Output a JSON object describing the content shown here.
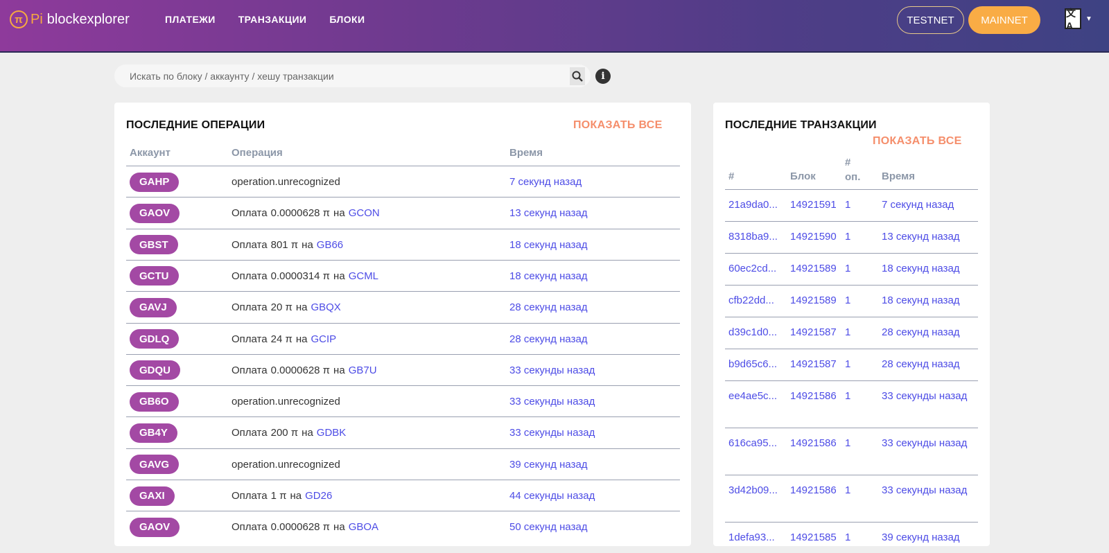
{
  "header": {
    "logo_symbol": "π",
    "logo_pi": "Pi",
    "logo_text": "blockexplorer",
    "nav": [
      "ПЛАТЕЖИ",
      "ТРАНЗАКЦИИ",
      "БЛОКИ"
    ],
    "testnet": "TESTNET",
    "mainnet": "MAINNET",
    "lang_icon": "文A",
    "accent_color": "#f9ac45"
  },
  "search": {
    "placeholder": "Искать по блоку / аккаунту / хешу транзакции"
  },
  "operations": {
    "title": "ПОСЛЕДНИЕ ОПЕРАЦИИ",
    "show_all": "ПОКАЗАТЬ ВСЕ",
    "columns": [
      "Аккаунт",
      "Операция",
      "Время"
    ],
    "rows": [
      {
        "account": "GAHP",
        "op": "operation.unrecognized",
        "amount": "",
        "to_word": "",
        "dest": "",
        "time": "7 секунд назад"
      },
      {
        "account": "GAOV",
        "op": "Оплата",
        "amount": "0.0000628 π",
        "to_word": "на",
        "dest": "GCON",
        "time": "13 секунд назад"
      },
      {
        "account": "GBST",
        "op": "Оплата",
        "amount": "801 π",
        "to_word": "на",
        "dest": "GB66",
        "time": "18 секунд назад"
      },
      {
        "account": "GCTU",
        "op": "Оплата",
        "amount": "0.0000314 π",
        "to_word": "на",
        "dest": "GCML",
        "time": "18 секунд назад"
      },
      {
        "account": "GAVJ",
        "op": "Оплата",
        "amount": "20 π",
        "to_word": "на",
        "dest": "GBQX",
        "time": "28 секунд назад"
      },
      {
        "account": "GDLQ",
        "op": "Оплата",
        "amount": "24 π",
        "to_word": "на",
        "dest": "GCIP",
        "time": "28 секунд назад"
      },
      {
        "account": "GDQU",
        "op": "Оплата",
        "amount": "0.0000628 π",
        "to_word": "на",
        "dest": "GB7U",
        "time": "33 секунды назад"
      },
      {
        "account": "GB6O",
        "op": "operation.unrecognized",
        "amount": "",
        "to_word": "",
        "dest": "",
        "time": "33 секунды назад"
      },
      {
        "account": "GB4Y",
        "op": "Оплата",
        "amount": "200 π",
        "to_word": "на",
        "dest": "GDBK",
        "time": "33 секунды назад"
      },
      {
        "account": "GAVG",
        "op": "operation.unrecognized",
        "amount": "",
        "to_word": "",
        "dest": "",
        "time": "39 секунд назад"
      },
      {
        "account": "GAXI",
        "op": "Оплата",
        "amount": "1 π",
        "to_word": "на",
        "dest": "GD26",
        "time": "44 секунды назад"
      },
      {
        "account": "GAOV",
        "op": "Оплата",
        "amount": "0.0000628 π",
        "to_word": "на",
        "dest": "GBOA",
        "time": "50 секунд назад"
      }
    ]
  },
  "transactions": {
    "title": "ПОСЛЕДНИЕ ТРАНЗАКЦИИ",
    "show_all": "ПОКАЗАТЬ ВСЕ",
    "columns": [
      "#",
      "Блок",
      "# оп.",
      "Время"
    ],
    "rows": [
      {
        "hash": "21a9da0...",
        "block": "14921591",
        "ops": "1",
        "time": "7 секунд назад"
      },
      {
        "hash": "8318ba9...",
        "block": "14921590",
        "ops": "1",
        "time": "13 секунд назад"
      },
      {
        "hash": "60ec2cd...",
        "block": "14921589",
        "ops": "1",
        "time": "18 секунд назад"
      },
      {
        "hash": "cfb22dd...",
        "block": "14921589",
        "ops": "1",
        "time": "18 секунд назад"
      },
      {
        "hash": "d39c1d0...",
        "block": "14921587",
        "ops": "1",
        "time": "28 секунд назад"
      },
      {
        "hash": "b9d65c6...",
        "block": "14921587",
        "ops": "1",
        "time": "28 секунд назад"
      },
      {
        "hash": "ee4ae5c...",
        "block": "14921586",
        "ops": "1",
        "time": "33 секунды назад"
      },
      {
        "hash": "616ca95...",
        "block": "14921586",
        "ops": "1",
        "time": "33 секунды назад"
      },
      {
        "hash": "3d42b09...",
        "block": "14921586",
        "ops": "1",
        "time": "33 секунды назад"
      },
      {
        "hash": "1defa93...",
        "block": "14921585",
        "ops": "1",
        "time": "39 секунд назад"
      }
    ]
  }
}
